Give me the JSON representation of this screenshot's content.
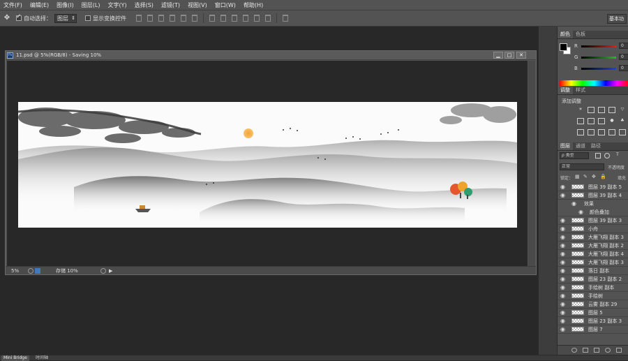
{
  "menu": [
    "文件(F)",
    "编辑(E)",
    "图像(I)",
    "图层(L)",
    "文字(Y)",
    "选择(S)",
    "滤镜(T)",
    "视图(V)",
    "窗口(W)",
    "帮助(H)"
  ],
  "options": {
    "auto_select_label": "自动选择：",
    "auto_select_value": "图层",
    "transform_label": "显示变换控件",
    "workspace": "基本功"
  },
  "document": {
    "title": "11.psd @ 5%(RGB/8) - Saving 10%",
    "zoom": "5%",
    "status": "存储 10%"
  },
  "color_panel": {
    "tabs": [
      "颜色",
      "色板"
    ],
    "channels": [
      {
        "letter": "R",
        "value": "0",
        "color": "#e02020"
      },
      {
        "letter": "G",
        "value": "0",
        "color": "#20c020"
      },
      {
        "letter": "B",
        "value": "0",
        "color": "#2040e0"
      }
    ]
  },
  "adjust_panel": {
    "tabs": [
      "调整",
      "样式"
    ],
    "title": "添加调整"
  },
  "layers_panel": {
    "tabs": [
      "图层",
      "通道",
      "路径"
    ],
    "filter": "ρ 类型",
    "blend_mode": "正常",
    "opacity_label": "不透明度",
    "lock_label": "锁定：",
    "fill_label": "填充",
    "effects_label": "效果",
    "effect_item": "颜色叠加",
    "layers": [
      "图层 39 副本 5",
      "图层 39 副本 4",
      "图层 39 副本 3",
      "小舟",
      "大雁飞翔 副本 3",
      "大雁飞翔 副本 2",
      "大雁飞翔 副本 4",
      "大雁飞翔 副本 3",
      "落日 副本",
      "图层 23 副本 2",
      "手绘树 副本",
      "手绘树",
      "云雾 副本 29",
      "图层 5",
      "图层 23 副本 3",
      "图层 7"
    ]
  },
  "bottom_tabs": [
    "Mini Bridge",
    "时间轴"
  ]
}
